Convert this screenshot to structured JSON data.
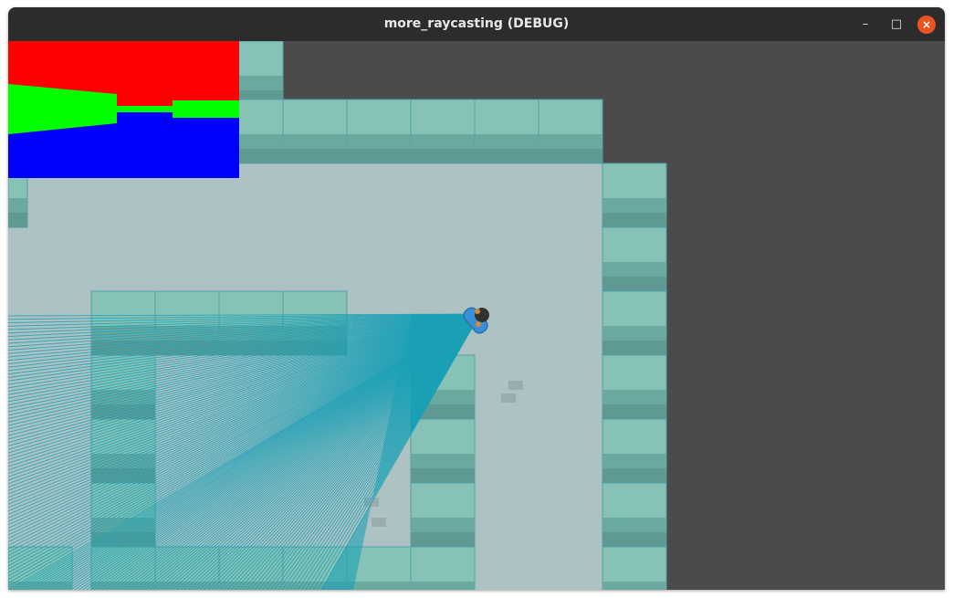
{
  "window": {
    "title": "more_raycasting (DEBUG)",
    "controls": {
      "minimize": "–",
      "maximize": "□",
      "close": "×"
    }
  },
  "scene": {
    "floor_color": "#aec2c4",
    "void_color": "#4b4b4b",
    "wall_colors": {
      "top": "#86c2b5",
      "face": "#6aa9a0",
      "dark": "#5e9a93",
      "edge": "#4fa3a8"
    },
    "ray_color": "#1aa0b5",
    "player": "blue-car"
  },
  "minimap": {
    "colors": {
      "ceiling": "#ff0000",
      "wall": "#00ff00",
      "floor": "#0000ff"
    }
  }
}
